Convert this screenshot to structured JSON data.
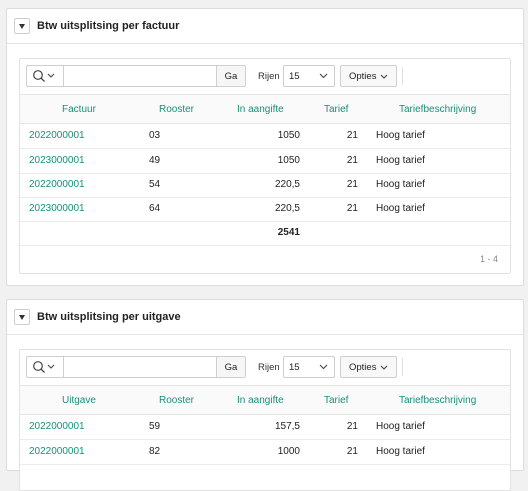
{
  "panels": [
    {
      "title": "Btw uitsplitsing per factuur",
      "search_placeholder": "",
      "go_label": "Ga",
      "rows_label": "Rijen",
      "rows_value": "15",
      "options_label": "Opties",
      "columns": [
        "Factuur",
        "Rooster",
        "In aangifte",
        "Tarief",
        "Tariefbeschrijving"
      ],
      "rows": [
        [
          "2022000001",
          "03",
          "1050",
          "21",
          "Hoog tarief"
        ],
        [
          "2023000001",
          "49",
          "1050",
          "21",
          "Hoog tarief"
        ],
        [
          "2022000001",
          "54",
          "220,5",
          "21",
          "Hoog tarief"
        ],
        [
          "2023000001",
          "64",
          "220,5",
          "21",
          "Hoog tarief"
        ]
      ],
      "total": "2541",
      "pagination": "1 - 4"
    },
    {
      "title": "Btw uitsplitsing per uitgave",
      "search_placeholder": "",
      "go_label": "Ga",
      "rows_label": "Rijen",
      "rows_value": "15",
      "options_label": "Opties",
      "columns": [
        "Uitgave",
        "Rooster",
        "In aangifte",
        "Tarief",
        "Tariefbeschrijving"
      ],
      "rows": [
        [
          "2022000001",
          "59",
          "157,5",
          "21",
          "Hoog tarief"
        ],
        [
          "2022000001",
          "82",
          "1000",
          "21",
          "Hoog tarief"
        ]
      ]
    }
  ]
}
